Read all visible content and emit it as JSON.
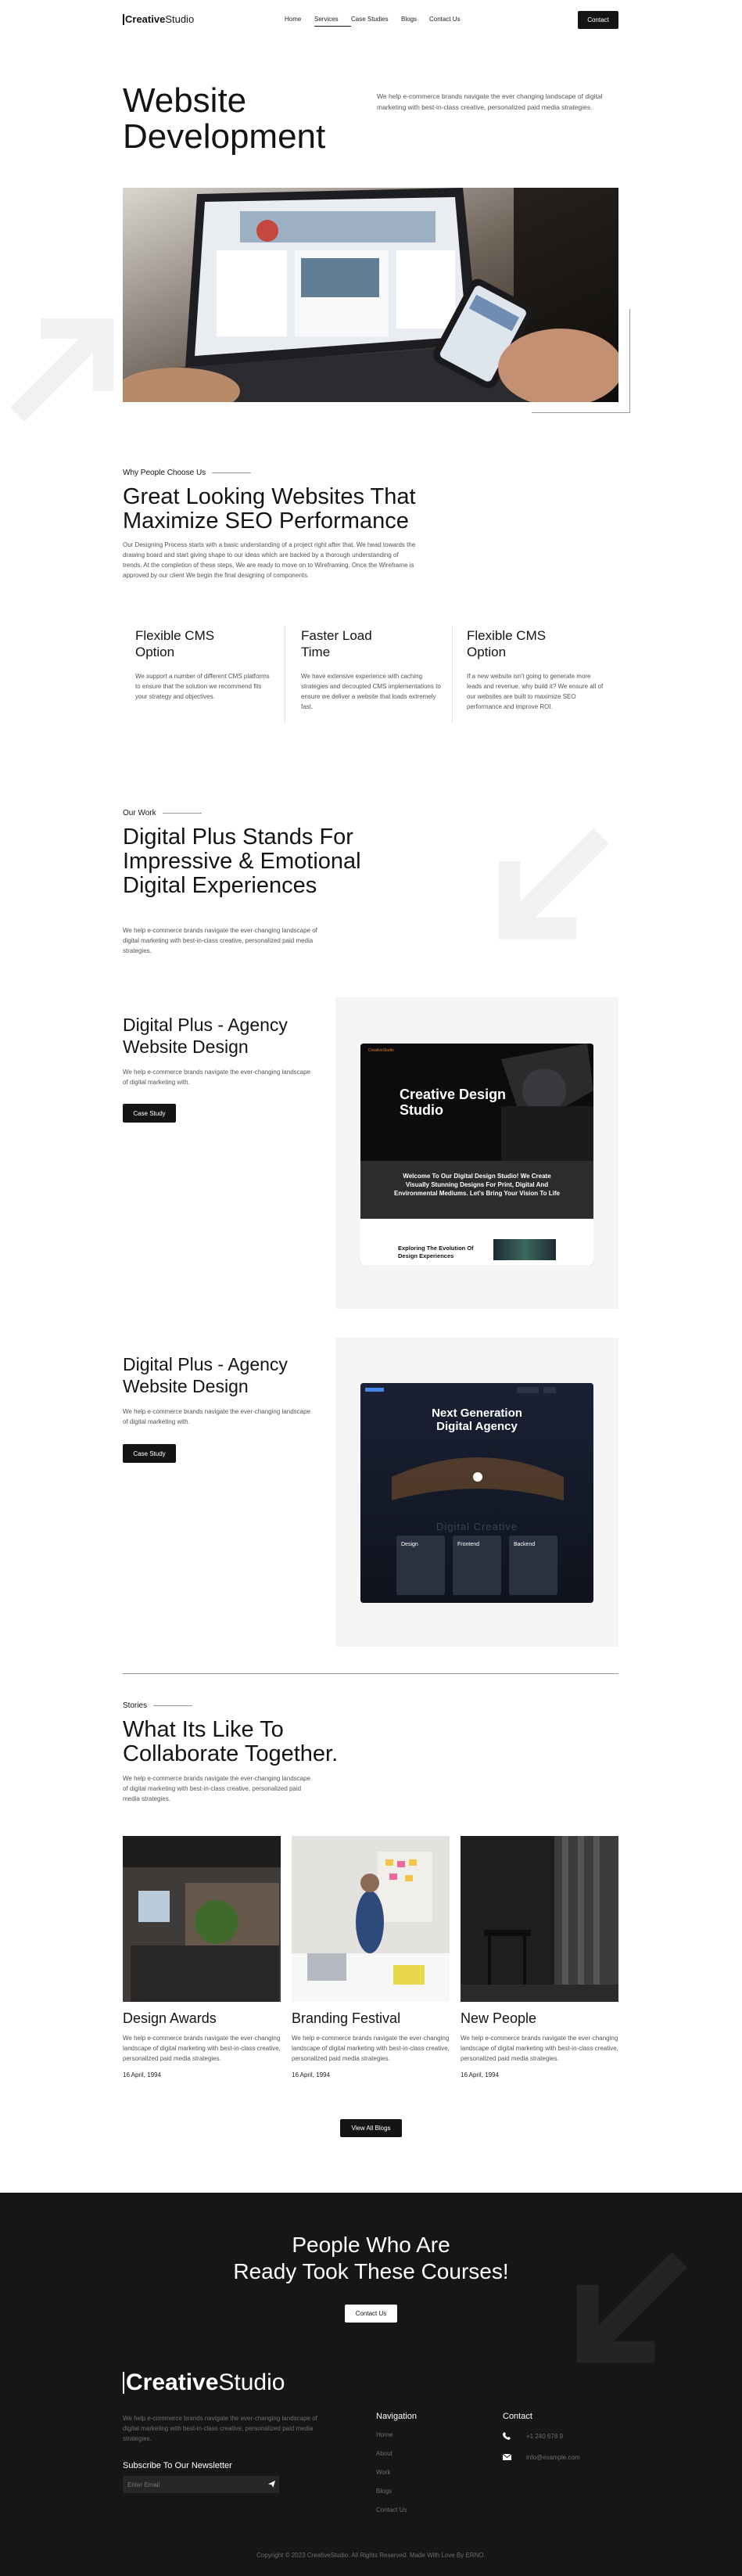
{
  "nav": {
    "logo_bold": "Creative",
    "logo_light": "Studio",
    "links": [
      "Home",
      "Services",
      "Case Studies",
      "Blogs",
      "Contact Us"
    ],
    "active": "Services",
    "contact_label": "Contact"
  },
  "hero": {
    "title": "Website Development",
    "description": "We help e-commerce brands navigate the ever changing landscape of digital marketing with best-in-class creative, personalized paid media strategies."
  },
  "why": {
    "eyebrow": "Why People Choose Us",
    "title": "Great Looking Websites That Maximize SEO Performance",
    "description": "Our Designing Process starts with a basic understanding of a project right after that. We head towards the drawing board and start giving shape to our ideas which are backed by a thorough understanding of trends. At the completion of these steps, We are ready to move on to Wireframing. Once the Wireframe is approved by our client We begin the final designing of components.",
    "features": [
      {
        "title": "Flexible CMS Option",
        "text": "We support a number of different CMS platforms to ensure that the solution we recommend fits your strategy and objectives."
      },
      {
        "title": "Faster Load Time",
        "text": "We have extensive experience with caching strategies and decoupled CMS implementations to ensure we deliver a website that loads extremely fast."
      },
      {
        "title": "Flexible CMS Option",
        "text": "If a new website isn't going to generate more leads and revenue, why build it? We ensure all of our websites are built to maximize SEO performance and improve ROI."
      }
    ]
  },
  "work": {
    "eyebrow": "Our Work",
    "title": "Digital Plus Stands For Impressive & Emotional Digital Experiences",
    "description": "We help e-commerce brands navigate the ever-changing landscape of digital marketing with best-in-class creative, personalized paid media strategies."
  },
  "cases": [
    {
      "title": "Digital Plus - Agency Website Design",
      "description": "We help e-commerce brands navigate the ever-changing landscape of digital marketing with.",
      "button": "Case Study",
      "mock": {
        "brand": "CreativeStudio",
        "headline": "Creative Design Studio",
        "band": "Welcome To Our Digital Design Studio! We Create Visually Stunning Designs For Print, Digital And Environmental Mediums. Let's Bring Your Vision To Life",
        "footer": "Exploring The Evolution Of Design Experiences"
      }
    },
    {
      "title": "Digital Plus - Agency Website Design",
      "description": "We help e-commerce brands navigate the ever-changing landscape of digital marketing with.",
      "button": "Case Study",
      "mock": {
        "headline": "Next Generation Digital Agency",
        "watermark": "Digital Creative",
        "cards": [
          "Design",
          "Frontend",
          "Backend"
        ]
      }
    }
  ],
  "stories": {
    "eyebrow": "Stories",
    "title": "What Its Like To Collaborate Together.",
    "description": "We help e-commerce brands navigate the ever-changing landscape of digital marketing with best-in-class creative, personalized paid media strategies.",
    "items": [
      {
        "title": "Design Awards",
        "text": "We help e-commerce brands navigate the ever-changing landscape of digital marketing with best-in-class creative, personalized paid media strategies.",
        "date": "16 April, 1994"
      },
      {
        "title": "Branding Festival",
        "text": "We help e-commerce brands navigate the ever-changing landscape of digital marketing with best-in-class creative, personalized paid media strategies.",
        "date": "16 April, 1994"
      },
      {
        "title": "New People",
        "text": "We help e-commerce brands navigate the ever-changing landscape of digital marketing with best-in-class creative, personalized paid media strategies.",
        "date": "16 April, 1994"
      }
    ],
    "view_all": "View All Blogs"
  },
  "footer": {
    "cta_line1": "People Who Are",
    "cta_line2": "Ready Took These Courses!",
    "cta_button": "Contact Us",
    "logo_bold": "Creative",
    "logo_light": "Studio",
    "description": "We help e-commerce brands navigate the ever-changing landscape of digital marketing with best-in-class creative, personalized paid media strategies.",
    "subscribe_title": "Subscribe To Our Newsletter",
    "email_placeholder": "Enter Email",
    "nav_title": "Navigation",
    "nav_links": [
      "Home",
      "About",
      "Work",
      "Blogs",
      "Contact Us"
    ],
    "contact_title": "Contact",
    "phone": "+1 240 678 9",
    "email": "info@example.com",
    "copyright": "Copyright © 2023 CreativeStudio. All Rights Reserved. Made With Love By ERNO."
  },
  "colors": {
    "dark": "#141414",
    "footer_bg": "#161616",
    "panel_bg": "#f4f4f4",
    "muted": "#555555"
  }
}
